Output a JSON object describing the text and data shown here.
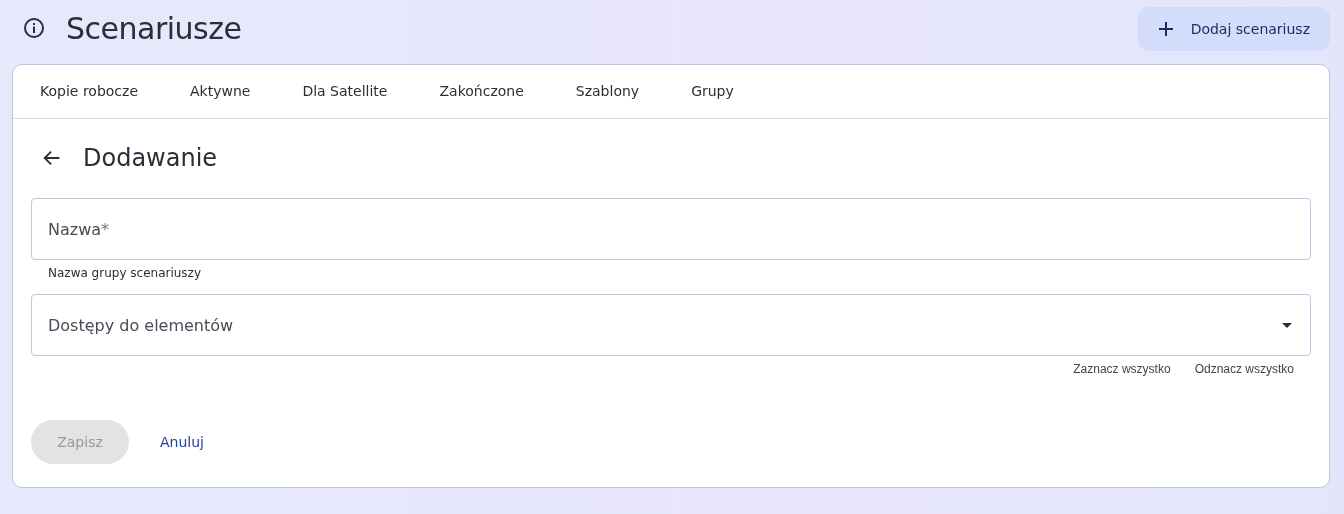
{
  "header": {
    "title": "Scenariusze",
    "add_button": "Dodaj scenariusz"
  },
  "tabs": [
    {
      "label": "Kopie robocze",
      "selected": false
    },
    {
      "label": "Aktywne",
      "selected": false
    },
    {
      "label": "Dla Satellite",
      "selected": false
    },
    {
      "label": "Zakończone",
      "selected": false
    },
    {
      "label": "Szablony",
      "selected": false
    },
    {
      "label": "Grupy",
      "selected": false
    }
  ],
  "form": {
    "title": "Dodawanie",
    "name_field": {
      "label": "Nazwa",
      "required_mark": "*",
      "helper": "Nazwa grupy scenariuszy"
    },
    "access_select": {
      "label": "Dostępy do elementów"
    },
    "select_all": "Zaznacz wszystko",
    "deselect_all": "Odznacz wszystko",
    "save_button": {
      "label": "Zapisz",
      "disabled": true
    },
    "cancel_link": "Anuluj"
  }
}
